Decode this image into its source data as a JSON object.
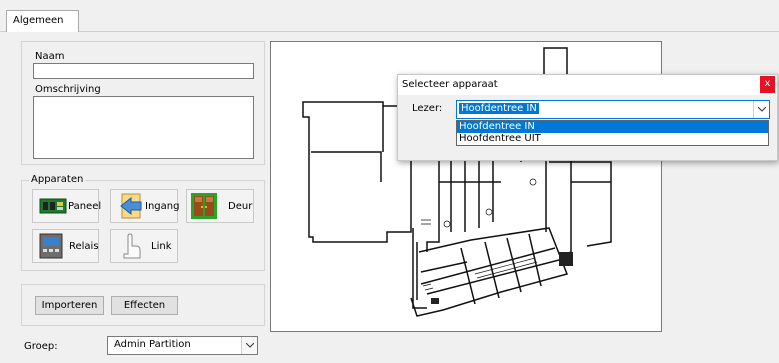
{
  "tabs": [
    {
      "label": "Algemeen"
    }
  ],
  "form": {
    "naam_label": "Naam",
    "naam_value": "",
    "omschrijving_label": "Omschrijving",
    "omschrijving_value": ""
  },
  "apparaten": {
    "title": "Apparaten",
    "buttons": [
      {
        "label": "Paneel",
        "icon": "panel-board-icon"
      },
      {
        "label": "Ingang",
        "icon": "entrance-arrow-icon"
      },
      {
        "label": "Deur",
        "icon": "door-icon"
      },
      {
        "label": "Relais",
        "icon": "relay-device-icon"
      },
      {
        "label": "Link",
        "icon": "link-icon"
      }
    ]
  },
  "actions": {
    "import_label": "Importeren",
    "effects_label": "Effecten"
  },
  "groep": {
    "label": "Groep:",
    "value": "Admin Partition"
  },
  "dialog": {
    "title": "Selecteer apparaat",
    "close_label": "x",
    "lezer_label": "Lezer:",
    "selected": "Hoofdentree IN",
    "options": [
      "Hoofdentree IN",
      "Hoofdentree UIT"
    ],
    "highlighted_index": 0
  },
  "colors": {
    "accent": "#0078d7",
    "close": "#e81123"
  }
}
